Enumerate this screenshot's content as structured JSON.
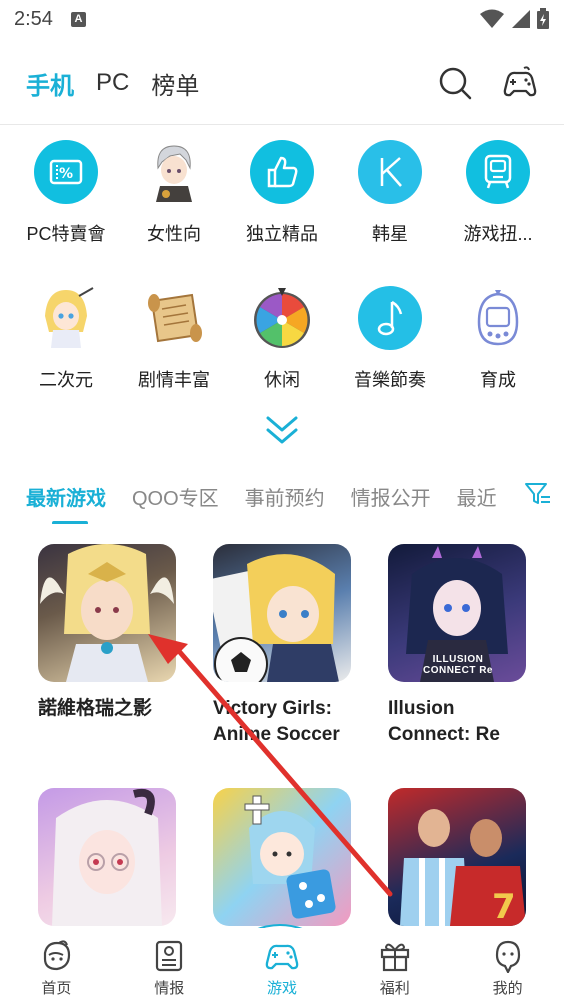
{
  "status": {
    "time": "2:54",
    "a_badge": "A"
  },
  "top_tabs": [
    {
      "label": "手机"
    },
    {
      "label": "PC"
    },
    {
      "label": "榜单"
    }
  ],
  "categories": [
    {
      "label": "PC特賣會",
      "icon": "ticket-percent-icon"
    },
    {
      "label": "女性向",
      "icon": "silver-hair-boy-icon"
    },
    {
      "label": "独立精品",
      "icon": "thumbs-up-icon"
    },
    {
      "label": "韩星",
      "icon": "k-letter-icon"
    },
    {
      "label": "游戏扭...",
      "icon": "gacha-machine-icon"
    },
    {
      "label": "二次元",
      "icon": "anime-girl-icon"
    },
    {
      "label": "剧情丰富",
      "icon": "scroll-icon"
    },
    {
      "label": "休闲",
      "icon": "color-wheel-icon"
    },
    {
      "label": "音樂節奏",
      "icon": "music-note-icon"
    },
    {
      "label": "育成",
      "icon": "tamagotchi-icon"
    }
  ],
  "game_tabs": [
    {
      "label": "最新游戏"
    },
    {
      "label": "QOO专区"
    },
    {
      "label": "事前预约"
    },
    {
      "label": "情报公开"
    },
    {
      "label": "最近"
    }
  ],
  "games": [
    {
      "title": "諾維格瑞之影"
    },
    {
      "title": "Victory Girls:\nAnime Soccer"
    },
    {
      "title": "Illusion\nConnect: Re",
      "thumb_text": "ILLUSION CONNECT Re"
    },
    {
      "title": ""
    },
    {
      "title": ""
    },
    {
      "title": ""
    }
  ],
  "bottom_nav": [
    {
      "label": "首页"
    },
    {
      "label": "情报"
    },
    {
      "label": "游戏"
    },
    {
      "label": "福利"
    },
    {
      "label": "我的"
    }
  ],
  "colors": {
    "accent": "#1ab0d6",
    "annotation_arrow": "#e0312c"
  }
}
